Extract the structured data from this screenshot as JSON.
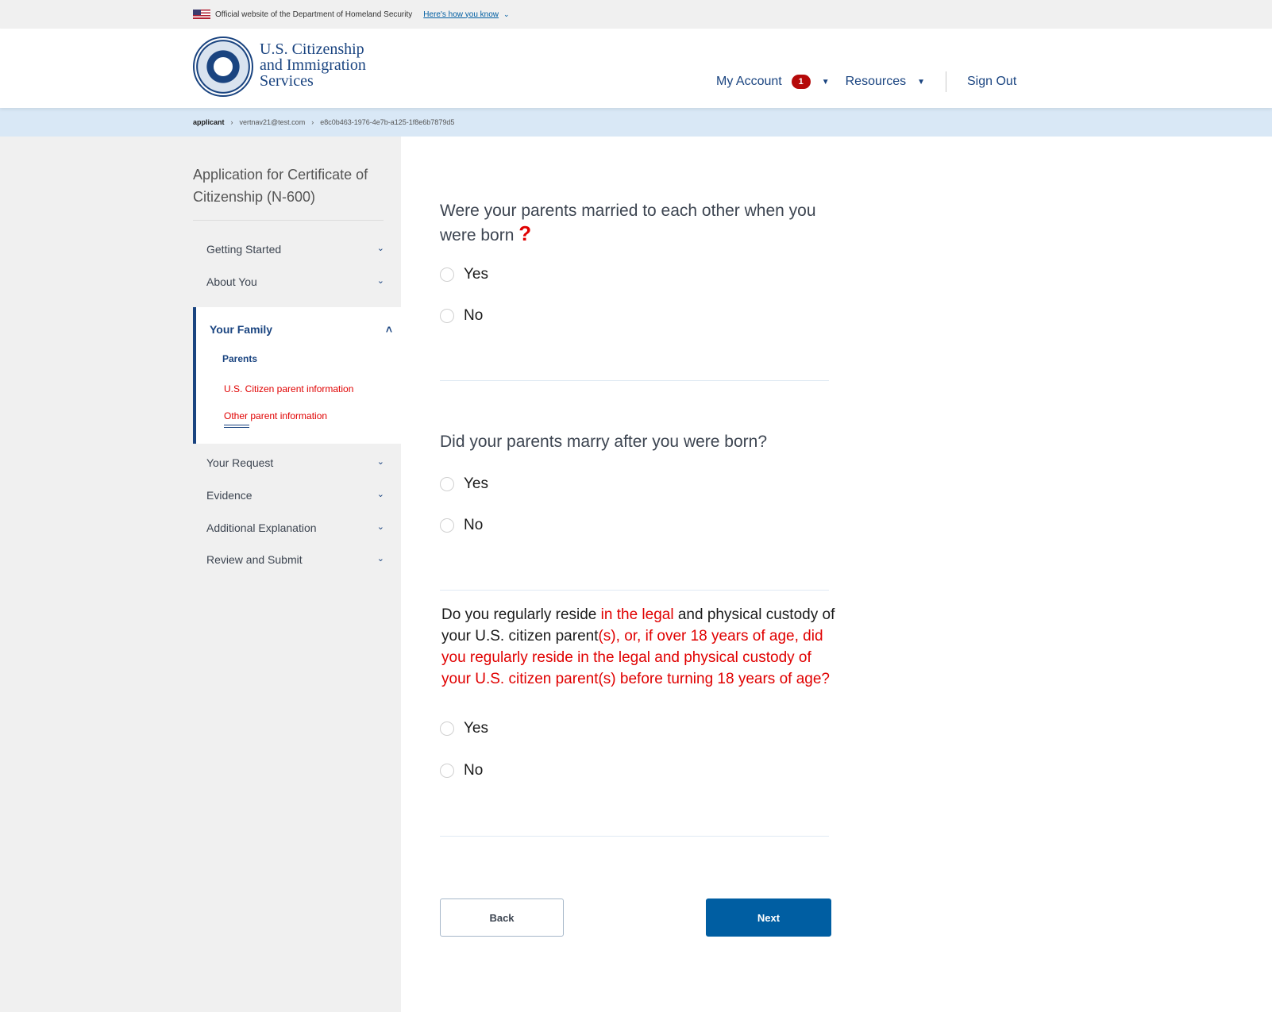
{
  "gov_banner": {
    "text": "Official website of the Department of Homeland Security",
    "link": "Here's how you know"
  },
  "header": {
    "agency_line1": "U.S. Citizenship",
    "agency_line2": "and Immigration",
    "agency_line3": "Services",
    "nav": {
      "my_account": "My Account",
      "notification_count": "1",
      "resources": "Resources",
      "sign_out": "Sign Out"
    }
  },
  "breadcrumb": {
    "items": [
      "applicant",
      "vertnav21@test.com",
      "e8c0b463-1976-4e7b-a125-1f8e6b7879d5"
    ]
  },
  "sidebar": {
    "title": "Application for Certificate of Citizenship (N-600)",
    "sections": [
      {
        "label": "Getting Started"
      },
      {
        "label": "About You"
      },
      {
        "label": "Your Family"
      },
      {
        "label": "Your Request"
      },
      {
        "label": "Evidence"
      },
      {
        "label": "Additional Explanation"
      },
      {
        "label": "Review and Submit"
      }
    ],
    "family_subitems": [
      "Parents",
      "U.S. Citizen parent information",
      "Other parent information"
    ]
  },
  "questions": {
    "q1": {
      "text": "Were your parents married to each other when you were born",
      "mark": "?",
      "yes": "Yes",
      "no": "No"
    },
    "q2": {
      "text": "Did your parents marry after you were born?",
      "yes": "Yes",
      "no": "No"
    },
    "q3": {
      "p1": "Do you regularly reside ",
      "p2": "in the legal",
      "p3": " and physical custody of your U.S. citizen parent",
      "p4": "(s), or, if over 18 years of age, did you regularly reside in the legal and physical custody of your U.S. citizen parent(s) before turning 18 years of age?",
      "yes": "Yes",
      "no": "No"
    }
  },
  "buttons": {
    "back": "Back",
    "next": "Next"
  },
  "colors": {
    "primary": "#005ea2",
    "navy": "#1a4480",
    "alert_red": "#e00000",
    "badge_red": "#b50909",
    "breadcrumb_bg": "#d9e8f6"
  }
}
